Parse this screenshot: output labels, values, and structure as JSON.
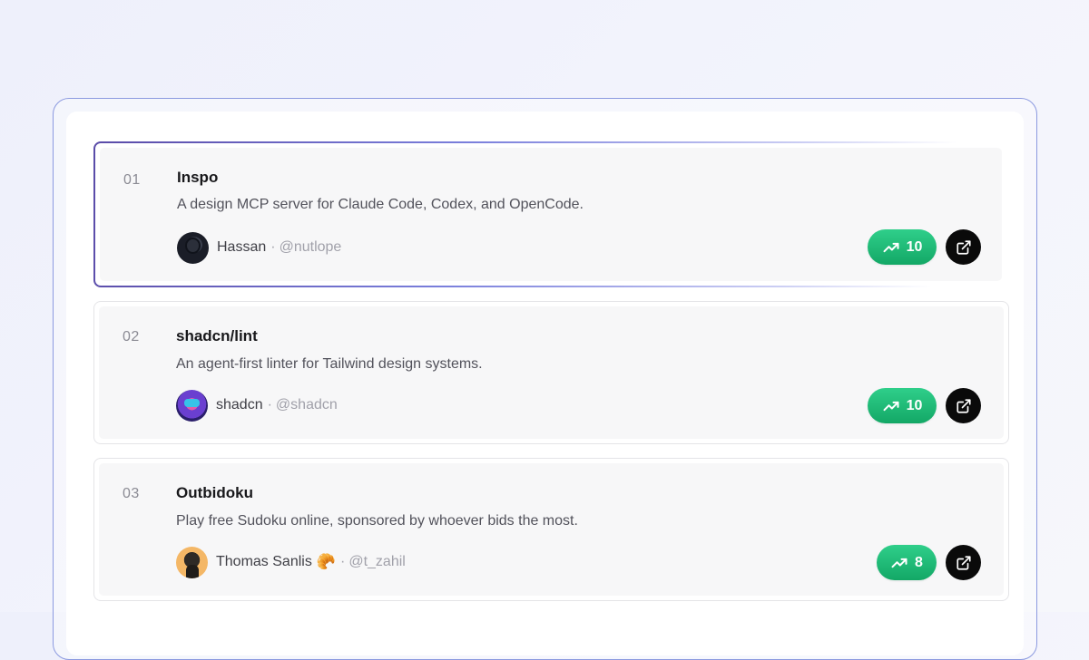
{
  "products": [
    {
      "rank": "01",
      "name": "Inspo",
      "description": "A design MCP server for Claude Code, Codex, and OpenCode.",
      "author": {
        "name": "Hassan",
        "handle": "@nutlope",
        "emoji": ""
      },
      "votes": "10",
      "active": true
    },
    {
      "rank": "02",
      "name": "shadcn/lint",
      "description": "An agent-first linter for Tailwind design systems.",
      "author": {
        "name": "shadcn",
        "handle": "@shadcn",
        "emoji": ""
      },
      "votes": "10",
      "active": false
    },
    {
      "rank": "03",
      "name": "Outbidoku",
      "description": "Play free Sudoku online, sponsored by whoever bids the most.",
      "author": {
        "name": "Thomas Sanlis",
        "handle": "@t_zahil",
        "emoji": "🥐"
      },
      "votes": "8",
      "active": false
    }
  ],
  "separator": "·",
  "icons": {
    "votes": "trending-up-icon",
    "open": "external-link-icon"
  },
  "colors": {
    "accent_border": "#8c9ae0",
    "vote_green": "#13a866",
    "open_button": "#0a0a0a"
  }
}
